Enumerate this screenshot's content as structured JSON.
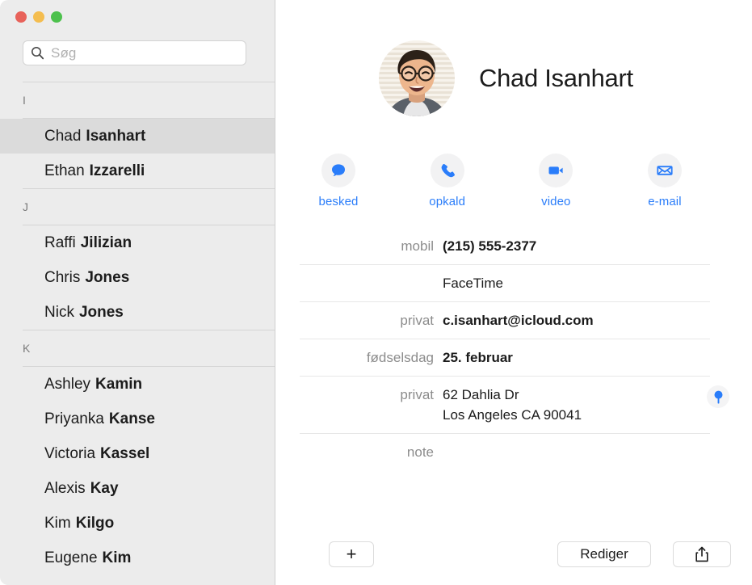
{
  "window": {
    "controls": [
      {
        "name": "close",
        "color": "#e8625a"
      },
      {
        "name": "minimize",
        "color": "#f4bd4f"
      },
      {
        "name": "maximize",
        "color": "#4cc14c"
      }
    ]
  },
  "search": {
    "placeholder": "Søg",
    "value": "",
    "icon": "search-icon"
  },
  "sidebar": {
    "sections": [
      {
        "letter": "I",
        "contacts": [
          {
            "first": "Chad",
            "last": "Isanhart",
            "selected": true
          },
          {
            "first": "Ethan",
            "last": "Izzarelli",
            "selected": false
          }
        ]
      },
      {
        "letter": "J",
        "contacts": [
          {
            "first": "Raffi",
            "last": "Jilizian",
            "selected": false
          },
          {
            "first": "Chris",
            "last": "Jones",
            "selected": false
          },
          {
            "first": "Nick",
            "last": "Jones",
            "selected": false
          }
        ]
      },
      {
        "letter": "K",
        "contacts": [
          {
            "first": "Ashley",
            "last": "Kamin",
            "selected": false
          },
          {
            "first": "Priyanka",
            "last": "Kanse",
            "selected": false
          },
          {
            "first": "Victoria",
            "last": "Kassel",
            "selected": false
          },
          {
            "first": "Alexis",
            "last": "Kay",
            "selected": false
          },
          {
            "first": "Kim",
            "last": "Kilgo",
            "selected": false
          },
          {
            "first": "Eugene",
            "last": "Kim",
            "selected": false
          }
        ]
      }
    ]
  },
  "detail": {
    "name": "Chad Isanhart",
    "avatar_alt": "contact-photo",
    "actions": [
      {
        "label": "besked",
        "icon": "message-bubble-icon"
      },
      {
        "label": "opkald",
        "icon": "phone-icon"
      },
      {
        "label": "video",
        "icon": "video-camera-icon"
      },
      {
        "label": "e-mail",
        "icon": "envelope-icon"
      }
    ],
    "fields": [
      {
        "label": "mobil",
        "value": "(215) 555-2377",
        "emphasis": true,
        "pin": false
      },
      {
        "label": "",
        "value": "FaceTime",
        "emphasis": false,
        "pin": false
      },
      {
        "label": "privat",
        "value": "c.isanhart@icloud.com",
        "emphasis": true,
        "pin": false
      },
      {
        "label": "fødselsdag",
        "value": "25. februar",
        "emphasis": true,
        "pin": false
      },
      {
        "label": "privat",
        "value": "62 Dahlia Dr\nLos Angeles CA 90041",
        "emphasis": false,
        "pin": true
      },
      {
        "label": "note",
        "value": "",
        "emphasis": false,
        "pin": false
      }
    ],
    "map_pin_icon": "map-pin-icon"
  },
  "bottom_bar": {
    "add_label": "+",
    "edit_label": "Rediger",
    "share_icon": "share-icon"
  },
  "colors": {
    "accent": "#2a7dfa",
    "sidebar_bg": "#ececec",
    "selected_row": "#dbdbdb",
    "separator": "#e7e7e7",
    "label_text": "#8c8c8c"
  }
}
